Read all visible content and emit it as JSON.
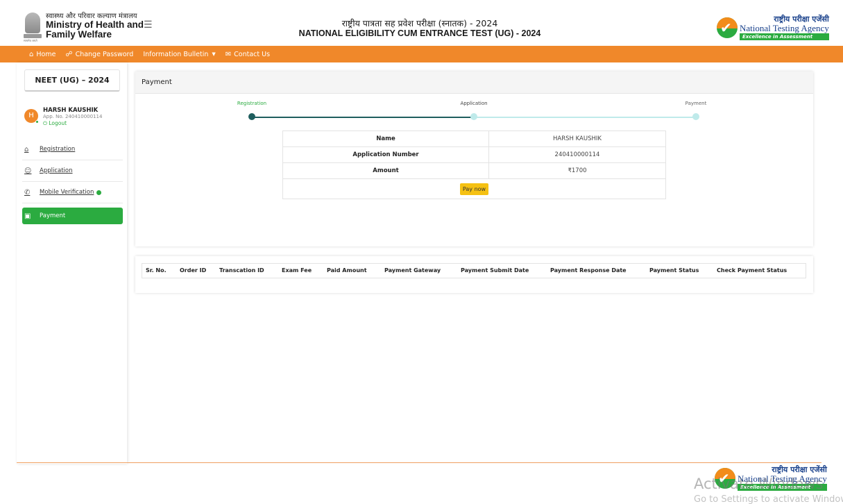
{
  "header": {
    "ministry_hindi": "स्वास्थ्य और परिवार कल्याण मंत्रालय",
    "ministry_line1": "Ministry of Health and",
    "ministry_line2": "Family Welfare",
    "emblem_motto": "सत्यमेव जयते",
    "title_hindi": "राष्ट्रीय पात्रता सह प्रवेश परीक्षा (स्नातक) - 2024",
    "title_english": "NATIONAL ELIGIBILITY CUM ENTRANCE TEST (UG) - 2024",
    "nta_hindi": "राष्ट्रीय परीक्षा एजेंसी",
    "nta_english": "National Testing Agency",
    "nta_tagline": "Excellence in Assessment"
  },
  "nav": {
    "home": "Home",
    "change_password": "Change Password",
    "information_bulletin": "Information Bulletin",
    "contact_us": "Contact Us"
  },
  "sidebar": {
    "exam": "NEET (UG) – 2024",
    "user_initial": "H",
    "user_name": "HARSH KAUSHIK",
    "app_no": "App. No. 240410000114",
    "logout": "Logout",
    "items": [
      {
        "label": "Registration",
        "icon": "home-icon"
      },
      {
        "label": "Application",
        "icon": "user-add-icon"
      },
      {
        "label": "Mobile Verification",
        "icon": "phone-icon"
      },
      {
        "label": "Payment",
        "icon": "card-icon"
      }
    ]
  },
  "payment": {
    "heading": "Payment",
    "steps": [
      "Registration",
      "Application",
      "Payment"
    ],
    "rows": [
      {
        "label": "Name",
        "value": "HARSH KAUSHIK"
      },
      {
        "label": "Application Number",
        "value": "240410000114"
      },
      {
        "label": "Amount",
        "value": "₹1700"
      }
    ],
    "pay_now": "Pay now"
  },
  "history": {
    "columns": [
      "Sr. No.",
      "Order ID",
      "Transcation ID",
      "Exam Fee",
      "Paid Amount",
      "Payment Gateway",
      "Payment Submit Date",
      "Payment Response Date",
      "Payment Status",
      "Check Payment Status"
    ]
  },
  "watermark": {
    "line1": "Activate Windows",
    "line2": "Go to Settings to activate Windows."
  },
  "colors": {
    "accent_orange": "#f0882a",
    "accent_green": "#2bab40",
    "step_done": "#1f5e5e",
    "step_pending": "#bfeaea",
    "button_yellow": "#f5c113"
  }
}
